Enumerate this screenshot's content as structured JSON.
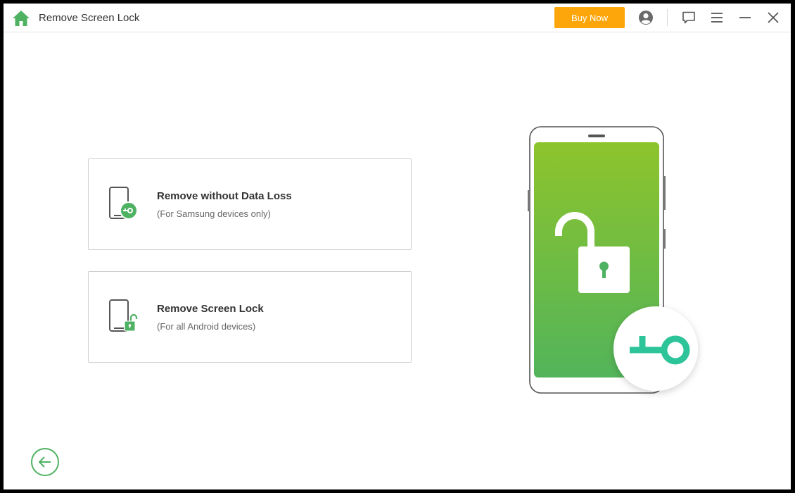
{
  "window": {
    "title": "Remove Screen Lock",
    "buy_label": "Buy Now"
  },
  "icons": {
    "home": "home-icon",
    "account": "user-account-icon",
    "feedback": "feedback-icon",
    "menu": "menu-icon",
    "minimize": "minimize-icon",
    "close": "close-icon",
    "back": "back-arrow-icon"
  },
  "options": [
    {
      "title": "Remove without Data Loss",
      "subtitle": "(For Samsung devices only)"
    },
    {
      "title": "Remove Screen Lock",
      "subtitle": "(For all Android devices)"
    }
  ],
  "colors": {
    "accent_green": "#4fb263",
    "buy_orange": "#fca60b",
    "key_teal": "#2ec49a"
  }
}
